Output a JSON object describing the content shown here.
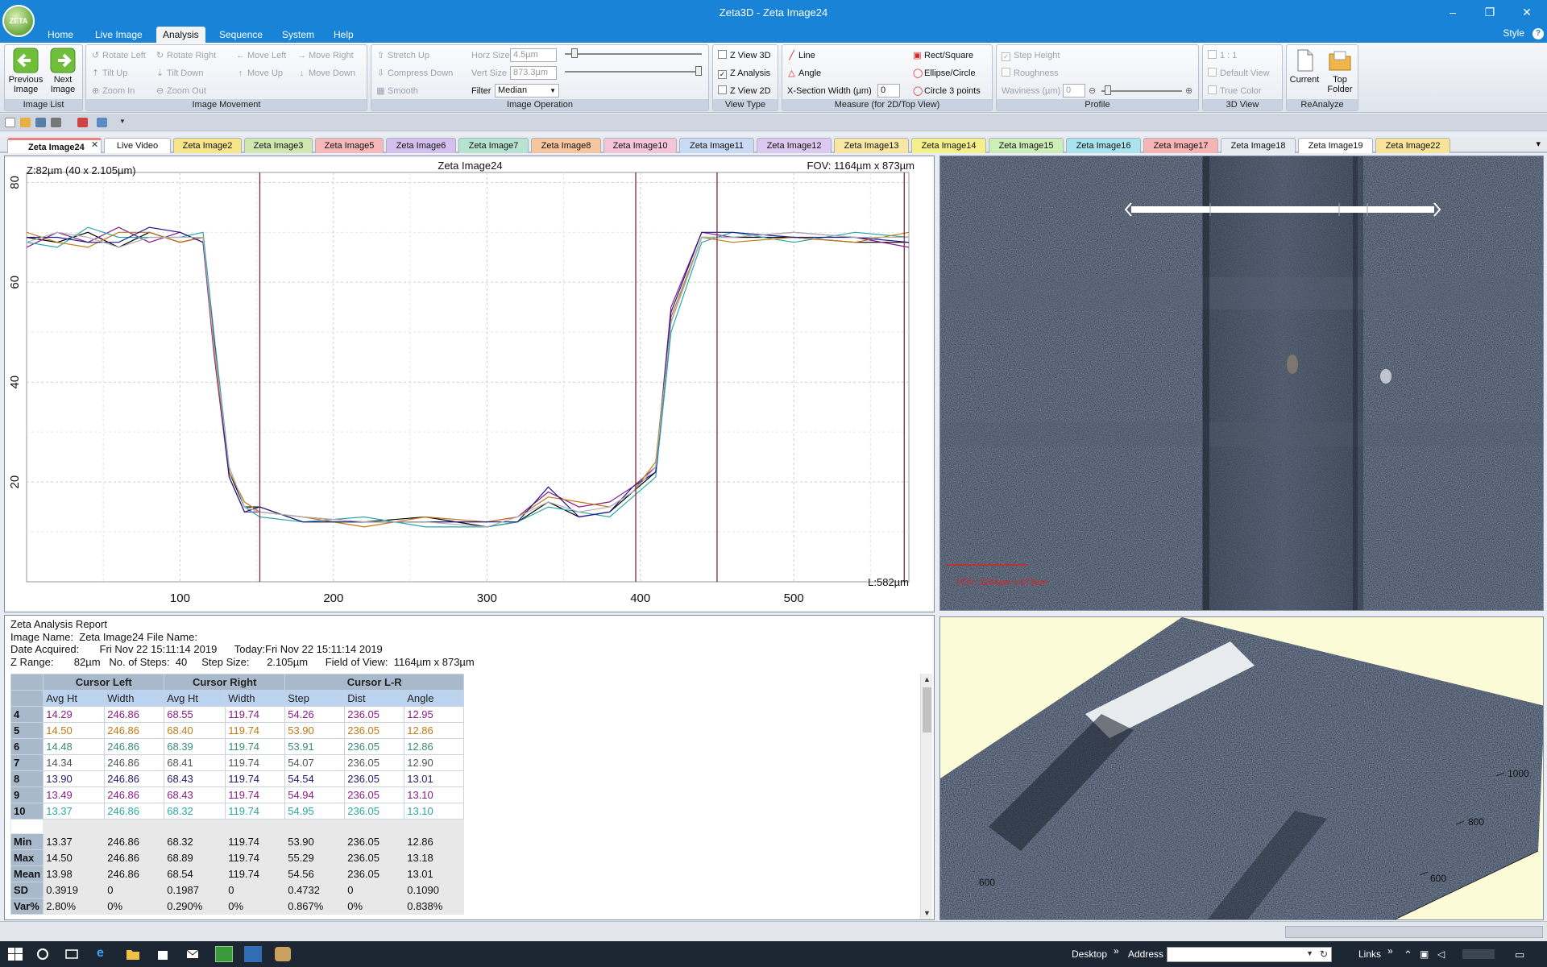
{
  "app": {
    "logo_text": "ZETA",
    "title": "Zeta3D - Zeta Image24",
    "minimize": "–",
    "restore": "❐",
    "close": "✕"
  },
  "menu": {
    "items": [
      "Home",
      "Live Image",
      "Analysis",
      "Sequence",
      "System",
      "Help"
    ],
    "active": "Analysis",
    "style": "Style",
    "help": "?"
  },
  "ribbon": {
    "image_list": {
      "label": "Image List",
      "prev": "Previous Image",
      "next": "Next Image"
    },
    "image_movement": {
      "label": "Image Movement",
      "rotate_left": "Rotate Left",
      "rotate_right": "Rotate Right",
      "move_left": "Move Left",
      "move_right": "Move Right",
      "tilt_up": "Tilt Up",
      "tilt_down": "Tilt Down",
      "move_up": "Move Up",
      "move_down": "Move Down",
      "zoom_in": "Zoom In",
      "zoom_out": "Zoom Out"
    },
    "image_operation": {
      "label": "Image Operation",
      "stretch_up": "Stretch Up",
      "compress_down": "Compress Down",
      "smooth": "Smooth",
      "horz_size_label": "Horz Size",
      "horz_size": "4.5µm",
      "vert_size_label": "Vert  Size",
      "vert_size": "873.3µm",
      "filter_label": "Filter",
      "filter": "Median"
    },
    "view_type": {
      "label": "View Type",
      "z_view_3d": "Z View 3D",
      "z_analysis": "Z Analysis",
      "z_view_2d": "Z View 2D",
      "z_analysis_checked": true
    },
    "measure": {
      "label": "Measure (for 2D/Top View)",
      "line": "Line",
      "angle": "Angle",
      "xsection_label": "X-Section Width (µm)",
      "xsection": "0",
      "rect": "Rect/Square",
      "ellipse": "Ellipse/Circle",
      "circle3": "Circle 3 points"
    },
    "profile": {
      "label": "Profile",
      "step_height": "Step Height",
      "roughness": "Roughness",
      "waviness_label": "Waviness (µm)",
      "waviness": "0"
    },
    "view3d": {
      "label": "3D View",
      "one_to_one": "1 : 1",
      "default_view": "Default View",
      "true_color": "True Color"
    },
    "reanalyze": {
      "label": "ReAnalyze",
      "current": "Current",
      "top_folder": "Top Folder"
    }
  },
  "tabs": [
    {
      "label": "Zeta Image24",
      "color": "#f7c7c7",
      "active": true
    },
    {
      "label": "Live Video",
      "color": "#ffffff"
    },
    {
      "label": "Zeta Image2",
      "color": "#f6e58a"
    },
    {
      "label": "Zeta Image3",
      "color": "#cfe8b0"
    },
    {
      "label": "Zeta Image5",
      "color": "#f6b9b9"
    },
    {
      "label": "Zeta Image6",
      "color": "#d3c0ee"
    },
    {
      "label": "Zeta Image7",
      "color": "#b7e3d1"
    },
    {
      "label": "Zeta Image8",
      "color": "#f7c59f"
    },
    {
      "label": "Zeta Image10",
      "color": "#f4c4d8"
    },
    {
      "label": "Zeta Image11",
      "color": "#c9daf4"
    },
    {
      "label": "Zeta Image12",
      "color": "#dcc9ef"
    },
    {
      "label": "Zeta Image13",
      "color": "#f7e6a4"
    },
    {
      "label": "Zeta Image14",
      "color": "#f4f08c"
    },
    {
      "label": "Zeta Image15",
      "color": "#cdeeb8"
    },
    {
      "label": "Zeta Image16",
      "color": "#a9e3ee"
    },
    {
      "label": "Zeta Image17",
      "color": "#f6b4b4"
    },
    {
      "label": "Zeta Image18",
      "color": "#e7ebf2"
    },
    {
      "label": "Zeta Image19",
      "color": "#ffffff"
    },
    {
      "label": "Zeta Image22",
      "color": "#f7e39a"
    }
  ],
  "plot": {
    "z_label": "Z:82µm (40 x 2.105µm)",
    "title": "Zeta Image24",
    "fov": "FOV: 1164µm x 873µm",
    "length": "L:582µm"
  },
  "chart_data": {
    "type": "line",
    "title": "Zeta Image24",
    "xlabel": "",
    "ylabel": "",
    "xlim": [
      0,
      575
    ],
    "ylim": [
      0,
      82
    ],
    "xticks": [
      100,
      200,
      300,
      400,
      500
    ],
    "yticks": [
      20,
      40,
      60,
      80
    ],
    "grid": true,
    "cursors_x": [
      152,
      397,
      450,
      572
    ],
    "series": [
      {
        "color": "#000000",
        "x": [
          0,
          20,
          40,
          60,
          80,
          100,
          115,
          122,
          132,
          142,
          152,
          180,
          220,
          260,
          300,
          320,
          340,
          360,
          380,
          395,
          410,
          420,
          440,
          460,
          500,
          540,
          575
        ],
        "y": [
          69,
          68,
          70,
          67,
          70,
          68,
          69,
          48,
          22,
          15,
          15,
          12,
          12,
          13,
          11,
          12,
          16,
          13,
          14,
          18,
          22,
          52,
          69,
          69,
          69,
          68,
          68
        ]
      },
      {
        "color": "#8b1c8b",
        "x": [
          0,
          20,
          40,
          60,
          80,
          100,
          115,
          122,
          132,
          142,
          152,
          180,
          220,
          260,
          300,
          320,
          340,
          360,
          380,
          395,
          410,
          420,
          440,
          460,
          500,
          540,
          575
        ],
        "y": [
          67,
          70,
          68,
          71,
          68,
          70,
          68,
          46,
          21,
          14,
          14,
          13,
          12,
          12,
          12,
          13,
          18,
          15,
          16,
          19,
          23,
          55,
          70,
          69,
          70,
          69,
          67
        ]
      },
      {
        "color": "#2aa6a6",
        "x": [
          0,
          20,
          40,
          60,
          80,
          100,
          115,
          122,
          132,
          142,
          152,
          180,
          220,
          260,
          300,
          320,
          340,
          360,
          380,
          395,
          410,
          420,
          440,
          460,
          500,
          540,
          575
        ],
        "y": [
          68,
          67,
          71,
          69,
          69,
          69,
          70,
          50,
          23,
          15,
          13,
          12,
          13,
          11,
          11,
          12,
          15,
          14,
          13,
          17,
          21,
          50,
          68,
          70,
          68,
          70,
          69
        ]
      },
      {
        "color": "#c07a14",
        "x": [
          0,
          20,
          40,
          60,
          80,
          100,
          115,
          122,
          132,
          142,
          152,
          180,
          220,
          260,
          300,
          320,
          340,
          360,
          380,
          395,
          410,
          420,
          440,
          460,
          500,
          540,
          575
        ],
        "y": [
          70,
          68,
          67,
          70,
          70,
          68,
          69,
          47,
          22,
          16,
          14,
          13,
          11,
          13,
          12,
          13,
          17,
          16,
          15,
          18,
          24,
          53,
          69,
          68,
          69,
          68,
          70
        ]
      },
      {
        "color": "#1c1c8b",
        "x": [
          0,
          20,
          40,
          60,
          80,
          100,
          115,
          122,
          132,
          142,
          152,
          180,
          220,
          260,
          300,
          320,
          340,
          360,
          380,
          395,
          410,
          420,
          440,
          460,
          500,
          540,
          575
        ],
        "y": [
          69,
          69,
          68,
          68,
          71,
          70,
          68,
          49,
          21,
          14,
          15,
          12,
          12,
          12,
          12,
          12,
          19,
          13,
          14,
          19,
          22,
          54,
          70,
          70,
          69,
          69,
          68
        ]
      },
      {
        "color": "#b0b0b0",
        "x": [
          0,
          20,
          40,
          60,
          80,
          100,
          115,
          122,
          132,
          142,
          152,
          180,
          220,
          260,
          300,
          320,
          340,
          360,
          380,
          395,
          410,
          420,
          440,
          460,
          500,
          540,
          575
        ],
        "y": [
          68,
          70,
          69,
          67,
          69,
          69,
          69,
          48,
          23,
          15,
          14,
          13,
          12,
          12,
          11,
          13,
          16,
          14,
          15,
          18,
          23,
          52,
          69,
          69,
          70,
          69,
          69
        ]
      }
    ]
  },
  "report": {
    "title": "Zeta Analysis Report",
    "line1": "Image Name:  Zeta Image24 File Name:",
    "line2": "Date Acquired:       Fri Nov 22 15:11:14 2019      Today:Fri Nov 22 15:11:14 2019",
    "line3": "Z Range:       82µm   No. of Steps:  40     Step Size:      2.105µm      Field of View:  1164µm x 873µm",
    "groups": [
      "Cursor Left",
      "Cursor Right",
      "Cursor L-R"
    ],
    "columns": [
      "Avg Ht",
      "Width",
      "Avg Ht",
      "Width",
      "Step",
      "Dist",
      "Angle"
    ],
    "rows": [
      {
        "id": "4",
        "color": "#8b1c8b",
        "cells": [
          "14.29",
          "246.86",
          "68.55",
          "119.74",
          "54.26",
          "236.05",
          "12.95"
        ]
      },
      {
        "id": "5",
        "color": "#c07a14",
        "cells": [
          "14.50",
          "246.86",
          "68.40",
          "119.74",
          "53.90",
          "236.05",
          "12.86"
        ]
      },
      {
        "id": "6",
        "color": "#3a8a7a",
        "cells": [
          "14.48",
          "246.86",
          "68.39",
          "119.74",
          "53.91",
          "236.05",
          "12.86"
        ]
      },
      {
        "id": "7",
        "color": "#555555",
        "cells": [
          "14.34",
          "246.86",
          "68.41",
          "119.74",
          "54.07",
          "236.05",
          "12.90"
        ]
      },
      {
        "id": "8",
        "color": "#1c1c6b",
        "cells": [
          "13.90",
          "246.86",
          "68.43",
          "119.74",
          "54.54",
          "236.05",
          "13.01"
        ]
      },
      {
        "id": "9",
        "color": "#8b1c8b",
        "cells": [
          "13.49",
          "246.86",
          "68.43",
          "119.74",
          "54.94",
          "236.05",
          "13.10"
        ]
      },
      {
        "id": "10",
        "color": "#2aa6a6",
        "cells": [
          "13.37",
          "246.86",
          "68.32",
          "119.74",
          "54.95",
          "236.05",
          "13.10"
        ]
      }
    ],
    "stats": [
      {
        "id": "Min",
        "cells": [
          "13.37",
          "246.86",
          "68.32",
          "119.74",
          "53.90",
          "236.05",
          "12.86"
        ]
      },
      {
        "id": "Max",
        "cells": [
          "14.50",
          "246.86",
          "68.89",
          "119.74",
          "55.29",
          "236.05",
          "13.18"
        ]
      },
      {
        "id": "Mean",
        "cells": [
          "13.98",
          "246.86",
          "68.54",
          "119.74",
          "54.56",
          "236.05",
          "13.01"
        ]
      },
      {
        "id": "SD",
        "cells": [
          "0.3919",
          "0",
          "0.1987",
          "0",
          "0.4732",
          "0",
          "0.1090"
        ]
      },
      {
        "id": "Var%",
        "cells": [
          "2.80%",
          "0%",
          "0.290%",
          "0%",
          "0.867%",
          "0%",
          "0.838%"
        ]
      }
    ]
  },
  "view3d": {
    "ticks": [
      "1000",
      "800",
      "600",
      "600"
    ]
  },
  "taskbar": {
    "desktop": "Desktop",
    "address": "Address",
    "links": "Links",
    "chevron": "»"
  }
}
